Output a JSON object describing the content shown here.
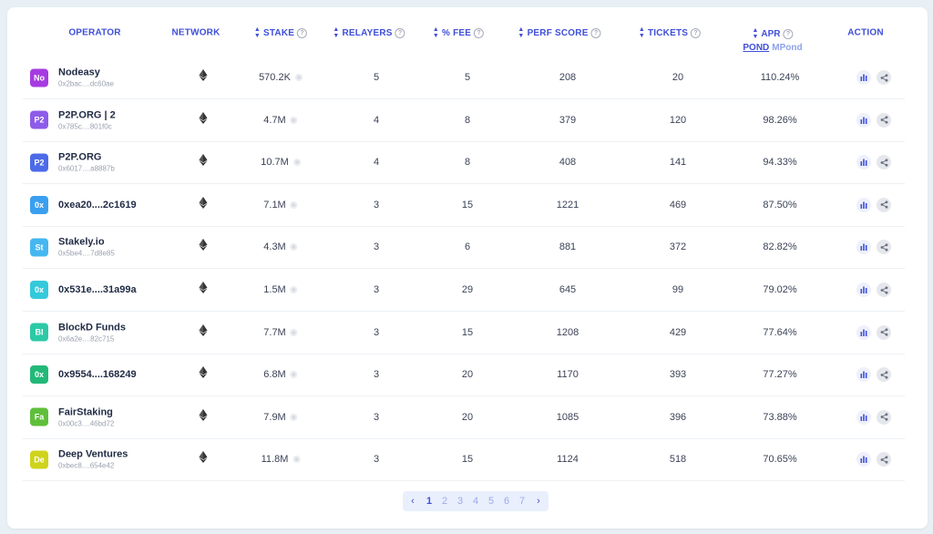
{
  "headers": {
    "operator": "OPERATOR",
    "network": "NETWORK",
    "stake": "STAKE",
    "relayers": "RELAYERS",
    "fee": "% FEE",
    "perf": "PERF SCORE",
    "tickets": "TICKETS",
    "apr": "APR",
    "apr_pond": "POND",
    "apr_mpond": "MPond",
    "action": "ACTION"
  },
  "rows": [
    {
      "avatar": "No",
      "color": "#a63be0",
      "name": "Nodeasy",
      "addr": "0x2bac....dc60ae",
      "stake": "570.2K",
      "relayers": "5",
      "fee": "5",
      "perf": "208",
      "tickets": "20",
      "apr": "110.24%"
    },
    {
      "avatar": "P2",
      "color": "#8e5bea",
      "name": "P2P.ORG | 2",
      "addr": "0x785c....801f0c",
      "stake": "4.7M",
      "relayers": "4",
      "fee": "8",
      "perf": "379",
      "tickets": "120",
      "apr": "98.26%"
    },
    {
      "avatar": "P2",
      "color": "#4d6ae8",
      "name": "P2P.ORG",
      "addr": "0x6017....a8887b",
      "stake": "10.7M",
      "relayers": "4",
      "fee": "8",
      "perf": "408",
      "tickets": "141",
      "apr": "94.33%"
    },
    {
      "avatar": "0x",
      "color": "#3a9ff0",
      "name": "0xea20....2c1619",
      "addr": "",
      "stake": "7.1M",
      "relayers": "3",
      "fee": "15",
      "perf": "1221",
      "tickets": "469",
      "apr": "87.50%"
    },
    {
      "avatar": "St",
      "color": "#45b7f0",
      "name": "Stakely.io",
      "addr": "0x5be4....7d8e85",
      "stake": "4.3M",
      "relayers": "3",
      "fee": "6",
      "perf": "881",
      "tickets": "372",
      "apr": "82.82%"
    },
    {
      "avatar": "0x",
      "color": "#35c9dc",
      "name": "0x531e....31a99a",
      "addr": "",
      "stake": "1.5M",
      "relayers": "3",
      "fee": "29",
      "perf": "645",
      "tickets": "99",
      "apr": "79.02%"
    },
    {
      "avatar": "Bl",
      "color": "#2dc9a6",
      "name": "BlockD Funds",
      "addr": "0x6a2e....82c715",
      "stake": "7.7M",
      "relayers": "3",
      "fee": "15",
      "perf": "1208",
      "tickets": "429",
      "apr": "77.64%"
    },
    {
      "avatar": "0x",
      "color": "#22b978",
      "name": "0x9554....168249",
      "addr": "",
      "stake": "6.8M",
      "relayers": "3",
      "fee": "20",
      "perf": "1170",
      "tickets": "393",
      "apr": "77.27%"
    },
    {
      "avatar": "Fa",
      "color": "#5fbf3a",
      "name": "FairStaking",
      "addr": "0x00c3....46bd72",
      "stake": "7.9M",
      "relayers": "3",
      "fee": "20",
      "perf": "1085",
      "tickets": "396",
      "apr": "73.88%"
    },
    {
      "avatar": "De",
      "color": "#cfd31c",
      "name": "Deep Ventures",
      "addr": "0xbec8....654e42",
      "stake": "11.8M",
      "relayers": "3",
      "fee": "15",
      "perf": "1124",
      "tickets": "518",
      "apr": "70.65%"
    }
  ],
  "pagination": {
    "prev": "‹",
    "next": "›",
    "pages": [
      "1",
      "2",
      "3",
      "4",
      "5",
      "6",
      "7"
    ],
    "active": "1"
  }
}
